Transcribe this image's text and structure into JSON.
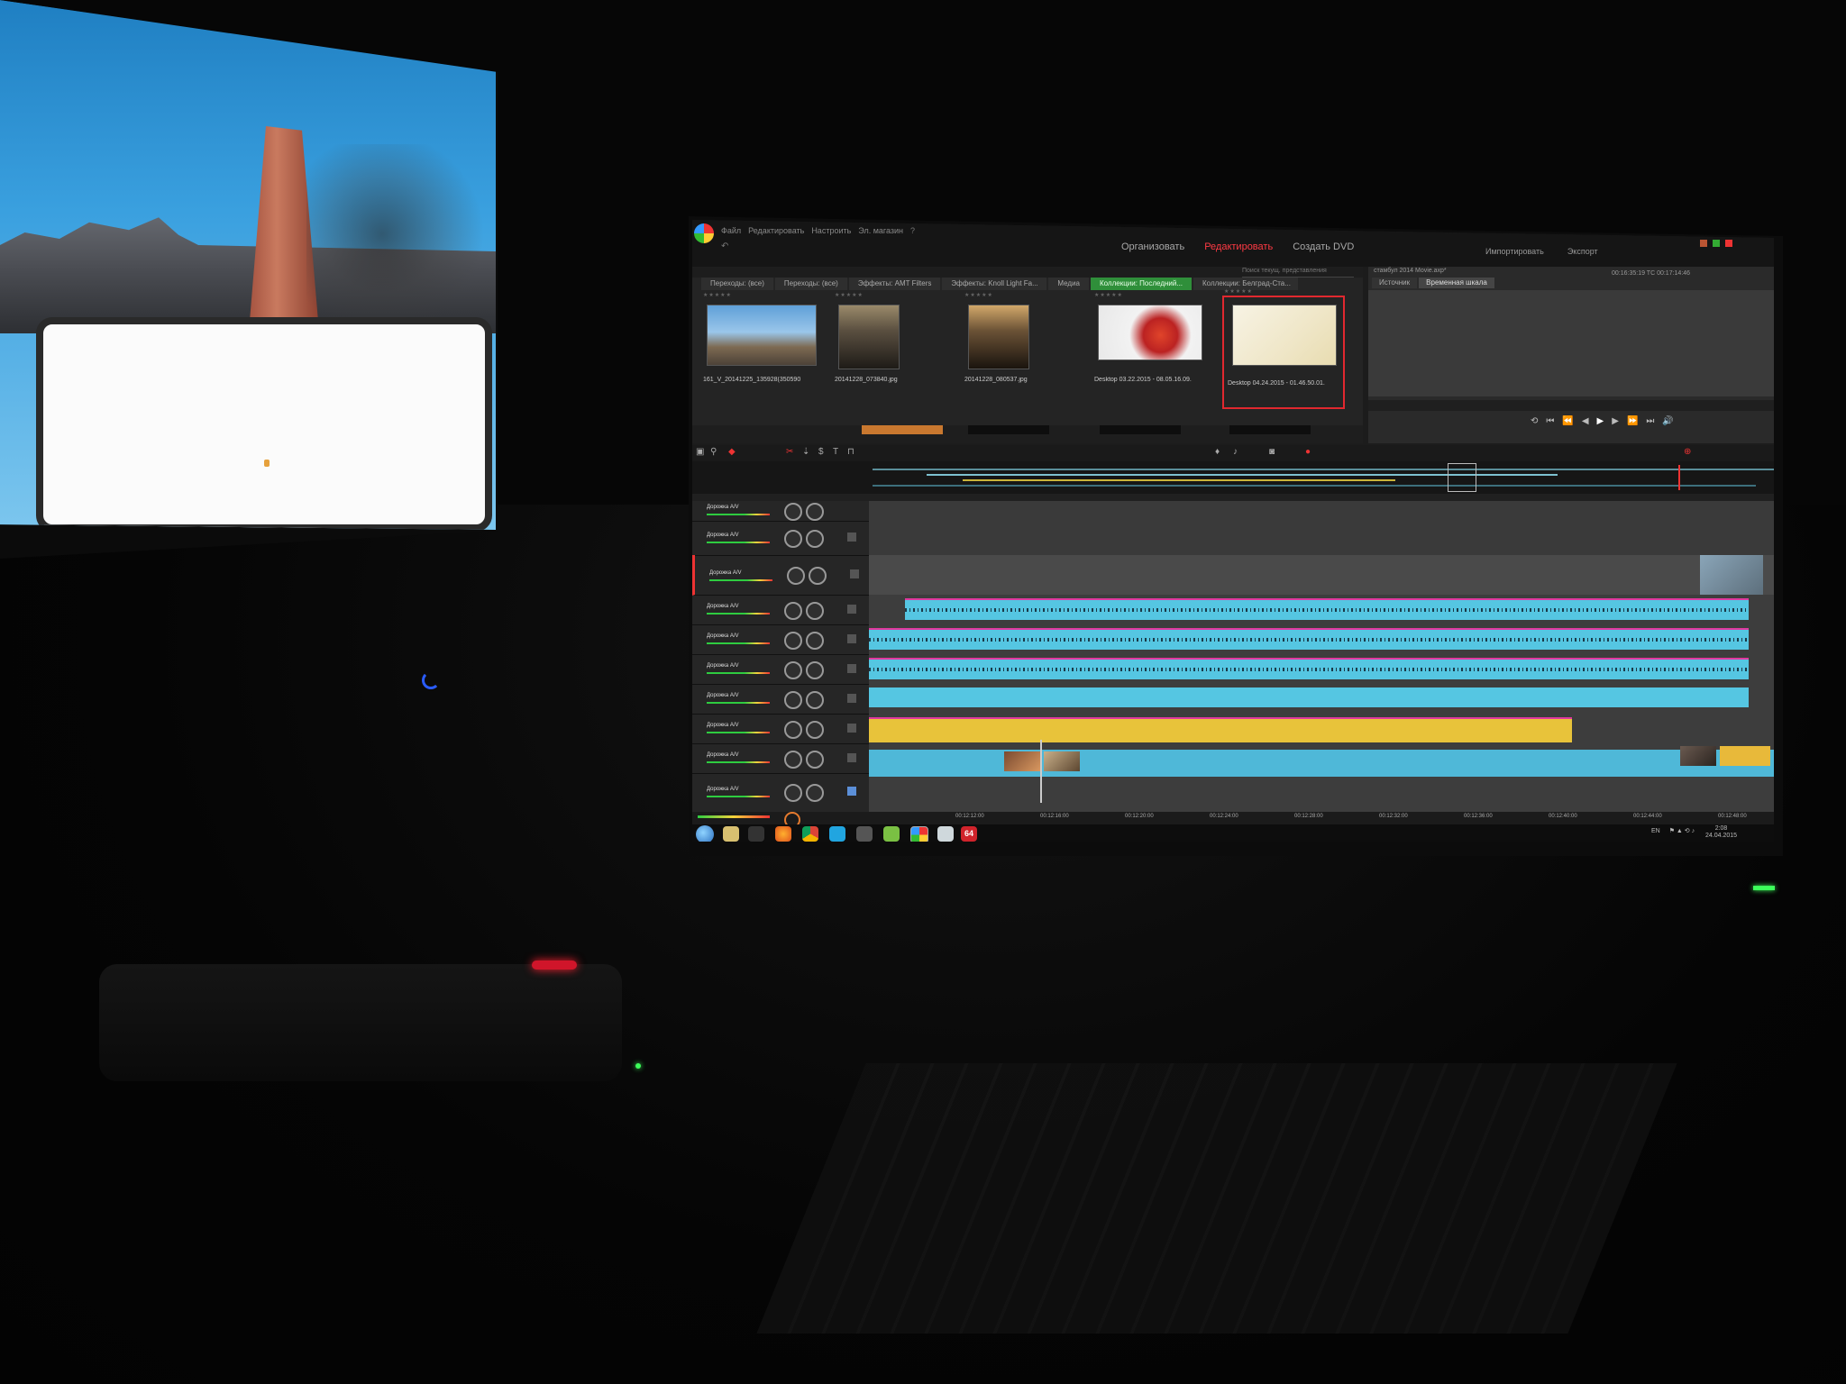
{
  "app": {
    "menu": [
      "Файл",
      "Редактировать",
      "Настроить",
      "Эл. магазин"
    ],
    "modes": [
      "Организовать",
      "Редактировать",
      "Создать DVD"
    ],
    "active_mode": "Редактировать",
    "right_tabs": [
      "Импортировать",
      "Экспорт"
    ],
    "accent_color": "#ff3a44"
  },
  "library": {
    "tabs": [
      "Переходы: (все)",
      "Переходы: (все)",
      "Эффекты: AMT Filters",
      "Эффекты: Knoll Light Fa...",
      "Медиа",
      "Коллекции: Последний...",
      "Коллекции: Белград-Ста..."
    ],
    "active_tab_index": 5,
    "search_placeholder": "Поиск текущ. представления",
    "items": [
      {
        "caption": "161_V_20141225_135928(3505904)..."
      },
      {
        "caption": "20141228_073840.jpg"
      },
      {
        "caption": "20141228_080537.jpg"
      },
      {
        "caption": "Desktop 03.22.2015 - 08.05.16.09.mp..."
      },
      {
        "caption": "Desktop 04.24.2015 - 01.46.50.01.mp..."
      }
    ],
    "selected_index": 4
  },
  "player": {
    "title": "стамбул 2014 Movie.axp*",
    "tabs": [
      "Источник",
      "Временная шкала"
    ],
    "active_tab": "Временная шкала",
    "timecode": "00:16:35:19   TC 00:17:14:46"
  },
  "timeline": {
    "track_label": "Дорожка A/V",
    "track_count": 10,
    "ruler_labels": [
      "00:12:12:00",
      "00:12:16:00",
      "00:12:20:00",
      "00:12:24:00",
      "00:12:28:00",
      "00:12:32:00",
      "00:12:36:00",
      "00:12:40:00",
      "00:12:44:00",
      "00:12:48:00"
    ]
  },
  "taskbar": {
    "language": "EN",
    "clock_time": "2:08",
    "clock_date": "24.04.2015",
    "badge_64": "64"
  },
  "colors": {
    "audio_clip": "#55c6e2",
    "audio_clip_outline": "#e0399f",
    "title_clip": "#e8c33a",
    "video_clip": "#4fb8d8",
    "selection": "#e1282f",
    "collection_tab": "#2f8f3a"
  }
}
